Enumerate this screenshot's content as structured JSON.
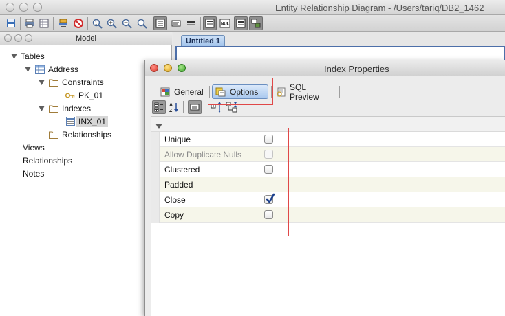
{
  "main_window": {
    "title": "Entity Relationship Diagram - /Users/tariq/DB2_1462"
  },
  "model_panel": {
    "title": "Model",
    "tree": [
      {
        "label": "Tables",
        "depth": 0,
        "expanded": true,
        "icon": "none"
      },
      {
        "label": "Address",
        "depth": 1,
        "expanded": true,
        "icon": "table-icon"
      },
      {
        "label": "Constraints",
        "depth": 2,
        "expanded": true,
        "icon": "folder-icon"
      },
      {
        "label": "PK_01",
        "depth": 3,
        "icon": "key-icon"
      },
      {
        "label": "Indexes",
        "depth": 2,
        "expanded": true,
        "icon": "folder-icon"
      },
      {
        "label": "INX_01",
        "depth": 3,
        "icon": "index-icon",
        "selected": true
      },
      {
        "label": "Relationships",
        "depth": 2,
        "icon": "folder-icon"
      },
      {
        "label": "Views",
        "depth": 0,
        "icon": "none"
      },
      {
        "label": "Relationships",
        "depth": 0,
        "icon": "none"
      },
      {
        "label": "Notes",
        "depth": 0,
        "icon": "none"
      }
    ]
  },
  "diagram": {
    "tab_label": "Untitled 1"
  },
  "dialog": {
    "title": "Index Properties",
    "tabs": [
      {
        "label": "General",
        "icon": "general-icon",
        "active": false
      },
      {
        "label": "Options",
        "icon": "options-icon",
        "active": true
      },
      {
        "label": "SQL Preview",
        "icon": "sql-preview-icon",
        "active": false
      }
    ],
    "properties": [
      {
        "name": "Unique",
        "checked": false,
        "enabled": true,
        "has_checkbox": true
      },
      {
        "name": "Allow Duplicate Nulls",
        "checked": false,
        "enabled": false,
        "has_checkbox": true
      },
      {
        "name": "Clustered",
        "checked": false,
        "enabled": true,
        "has_checkbox": true
      },
      {
        "name": "Padded",
        "checked": false,
        "enabled": true,
        "has_checkbox": false
      },
      {
        "name": "Close",
        "checked": true,
        "enabled": true,
        "has_checkbox": true
      },
      {
        "name": "Copy",
        "checked": false,
        "enabled": true,
        "has_checkbox": true
      }
    ]
  },
  "colors": {
    "highlight": "#e04848",
    "selection_blue": "#a9c8ee",
    "check_mark": "#1b3f8c"
  }
}
